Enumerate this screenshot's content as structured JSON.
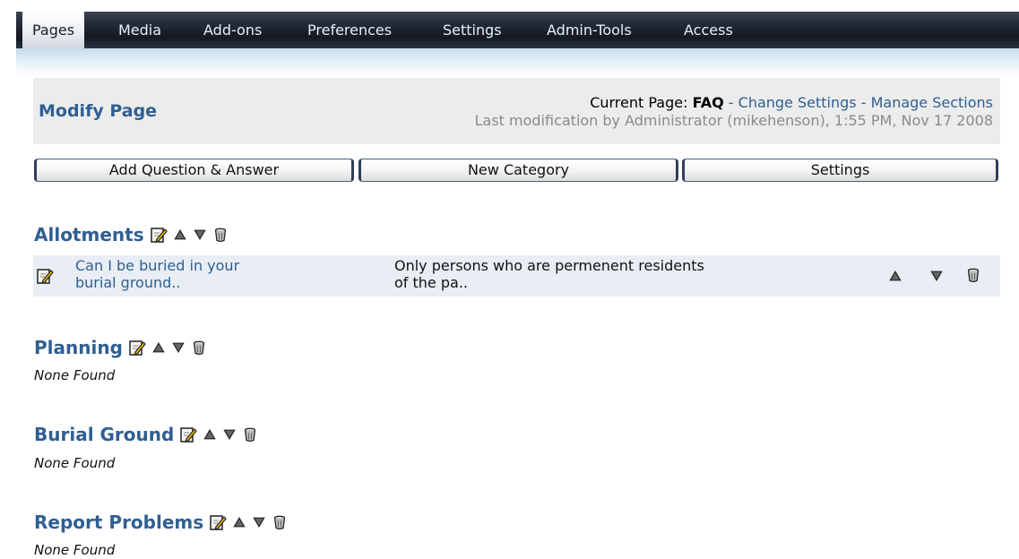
{
  "nav": {
    "tabs": [
      {
        "label": "Pages"
      },
      {
        "label": "Media"
      },
      {
        "label": "Add-ons"
      },
      {
        "label": "Preferences"
      },
      {
        "label": "Settings"
      },
      {
        "label": "Admin-Tools"
      },
      {
        "label": "Access"
      }
    ],
    "active_tab": "Pages"
  },
  "header": {
    "title": "Modify Page",
    "current_page_label": "Current Page:",
    "current_page": "FAQ",
    "separator": "-",
    "change_settings": "Change Settings",
    "manage_sections": "Manage Sections",
    "last_modification": "Last modification by Administrator (mikehenson), 1:55 PM, Nov 17 2008"
  },
  "buttons": {
    "add_qa": "Add Question & Answer",
    "new_category": "New Category",
    "settings": "Settings"
  },
  "categories": [
    {
      "title": "Allotments"
    },
    {
      "title": "Planning",
      "empty_text": "None Found"
    },
    {
      "title": "Burial Ground",
      "empty_text": "None Found"
    },
    {
      "title": "Report Problems",
      "empty_text": "None Found"
    }
  ],
  "allotments_items": [
    {
      "question_line1": "Can I be buried in your",
      "question_line2": "burial ground..",
      "answer_line1": "Only persons who are permenent residents",
      "answer_line2": "of the pa.."
    }
  ],
  "icons": {
    "edit": "edit-icon",
    "up": "move-up-icon",
    "down": "move-down-icon",
    "delete": "delete-icon"
  },
  "colors": {
    "link": "#2f5f92",
    "header_bg": "#ececec",
    "row_bg": "#e8eef4",
    "nav_bg": "#1c222d"
  }
}
